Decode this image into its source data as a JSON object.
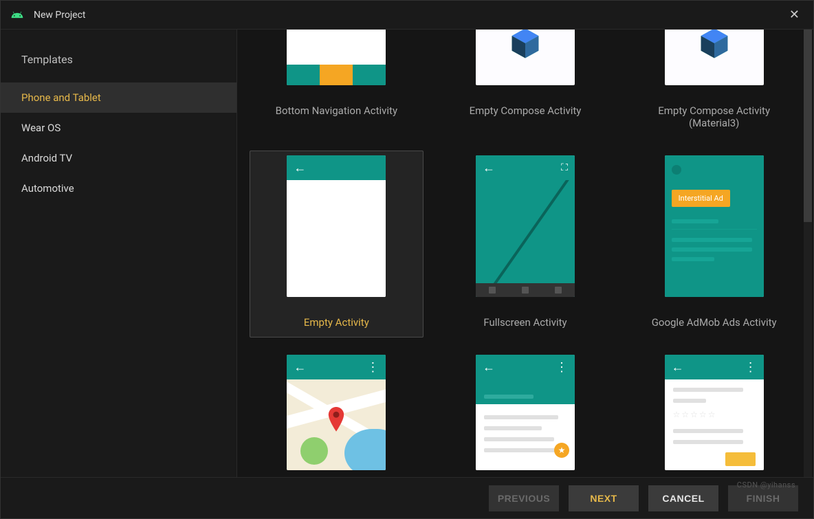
{
  "window": {
    "title": "New Project"
  },
  "sidebar": {
    "heading": "Templates",
    "items": [
      {
        "label": "Phone and Tablet",
        "selected": true
      },
      {
        "label": "Wear OS",
        "selected": false
      },
      {
        "label": "Android TV",
        "selected": false
      },
      {
        "label": "Automotive",
        "selected": false
      }
    ]
  },
  "templates": {
    "row0": [
      {
        "label": "Bottom Navigation Activity"
      },
      {
        "label": "Empty Compose Activity"
      },
      {
        "label": "Empty Compose Activity (Material3)"
      }
    ],
    "row1": [
      {
        "label": "Empty Activity",
        "selected": true
      },
      {
        "label": "Fullscreen Activity"
      },
      {
        "label": "Google AdMob Ads Activity"
      }
    ],
    "row2": [
      {
        "label": ""
      },
      {
        "label": ""
      },
      {
        "label": ""
      }
    ]
  },
  "admob": {
    "tag": "Interstitial Ad"
  },
  "footer": {
    "previous": "PREVIOUS",
    "next": "NEXT",
    "cancel": "CANCEL",
    "finish": "FINISH"
  },
  "watermark": "CSDN @yihanss"
}
